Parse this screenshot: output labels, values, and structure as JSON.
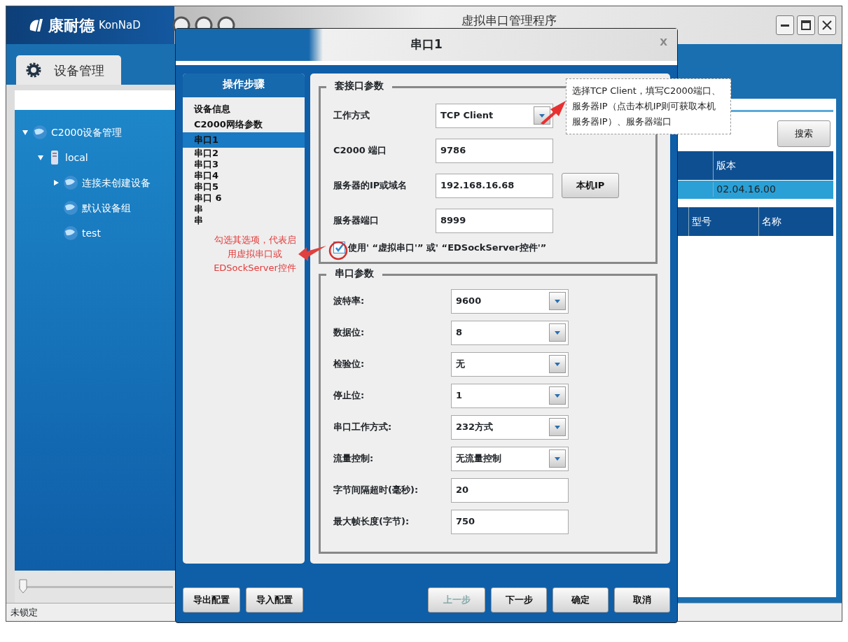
{
  "window": {
    "logo": "康耐德",
    "logo_latin": "KonNaD",
    "title": "虚拟串口管理程序"
  },
  "sidebar": {
    "tab": {
      "label": "设备管理",
      "selected": true
    },
    "tree": [
      {
        "label": "C2000设备管理",
        "expanded": true,
        "children": [
          {
            "label": "local",
            "expanded": true,
            "children": [
              {
                "label": "连接未创建设备",
                "expanded": false
              },
              {
                "label": "默认设备组"
              },
              {
                "label": "test"
              }
            ]
          }
        ]
      }
    ],
    "zoom_slider": {
      "level": 0
    }
  },
  "device_panel": {
    "search_button": "搜索",
    "table_1": {
      "columns": [
        "版本"
      ],
      "rows": [
        {
          "cells": [
            "02.04.16.00"
          ],
          "selected": true
        }
      ]
    },
    "table_2": {
      "columns": [
        "型号",
        "名称"
      ]
    }
  },
  "dialog": {
    "title": "串口1",
    "close": "X",
    "steps": {
      "title": "操作步骤",
      "items": [
        {
          "label": "设备信息",
          "selected": false
        },
        {
          "label": "C2000网络参数",
          "selected": false
        },
        {
          "label": "串口1",
          "selected": true
        },
        {
          "label": "串口2",
          "selected": false
        },
        {
          "label": "串口3",
          "selected": false
        },
        {
          "label": "串口4",
          "selected": false
        },
        {
          "label": "串口5",
          "selected": false
        },
        {
          "label": "串口 6",
          "selected": false
        },
        {
          "label": "串",
          "selected": false
        },
        {
          "label": "串",
          "selected": false
        }
      ]
    },
    "socket_params": {
      "legend": "套接口参数",
      "rows": [
        {
          "label": "工作方式",
          "kind": "select",
          "value": "TCP Client"
        },
        {
          "label": "C2000 端口",
          "kind": "input",
          "value": "9786"
        },
        {
          "label": "服务器的IP或域名",
          "kind": "input",
          "value": "192.168.16.68",
          "button": "本机IP"
        },
        {
          "label": "服务器端口",
          "kind": "input",
          "value": "8999"
        }
      ],
      "checkbox": {
        "label": "使用' “虚拟串口'” 或' “EDSockServer控件'”",
        "checked": true
      }
    },
    "serial_params": {
      "legend": "串口参数",
      "rows": [
        {
          "label": "波特率:",
          "kind": "select",
          "value": "9600"
        },
        {
          "label": "数据位:",
          "kind": "select",
          "value": "8"
        },
        {
          "label": "检验位:",
          "kind": "select",
          "value": "无"
        },
        {
          "label": "停止位:",
          "kind": "select",
          "value": "1"
        },
        {
          "label": "串口工作方式:",
          "kind": "select",
          "value": "232方式"
        },
        {
          "label": "流量控制:",
          "kind": "select",
          "value": "无流量控制"
        },
        {
          "label": "字节间隔超时(毫秒):",
          "kind": "input",
          "value": "20"
        },
        {
          "label": "最大帧长度(字节):",
          "kind": "input",
          "value": "750"
        }
      ]
    },
    "left_buttons": [
      {
        "label": "导出配置",
        "disabled": false
      },
      {
        "label": "导入配置",
        "disabled": false
      }
    ],
    "right_buttons": [
      {
        "label": "上一步",
        "disabled": true
      },
      {
        "label": "下一步",
        "disabled": false
      },
      {
        "label": "确定",
        "disabled": false
      },
      {
        "label": "取消",
        "disabled": false
      }
    ]
  },
  "annotations": [
    {
      "kind": "checkbox-note",
      "text": "勾选其选项，代表启用虚拟串口或EDSockServer控件"
    },
    {
      "kind": "mode-note",
      "text": "选择TCP Client，填写C2000端口、服务器IP（点击本机IP则可获取本机服务器IP）、服务器端口"
    }
  ],
  "status_bar": {
    "text": "未锁定"
  }
}
